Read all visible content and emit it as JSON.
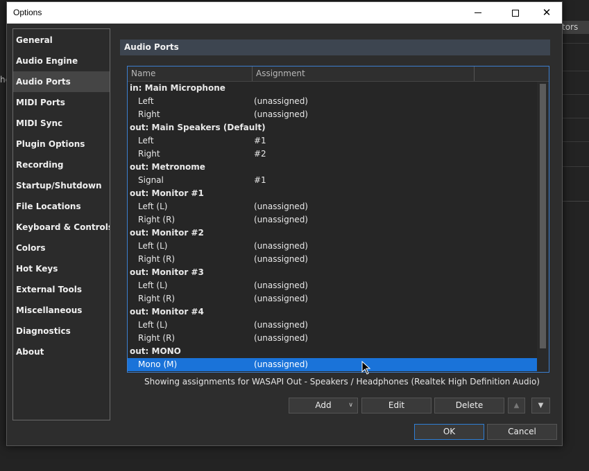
{
  "background": {
    "partial_tab_label": "tors",
    "partial_left_text": "he"
  },
  "window": {
    "title": "Options"
  },
  "sidebar": {
    "items": [
      {
        "label": "General"
      },
      {
        "label": "Audio Engine"
      },
      {
        "label": "Audio Ports",
        "selected": true
      },
      {
        "label": "MIDI Ports"
      },
      {
        "label": "MIDI Sync"
      },
      {
        "label": "Plugin Options"
      },
      {
        "label": "Recording"
      },
      {
        "label": "Startup/Shutdown"
      },
      {
        "label": "File Locations"
      },
      {
        "label": "Keyboard & Controls"
      },
      {
        "label": "Colors"
      },
      {
        "label": "Hot Keys"
      },
      {
        "label": "External Tools"
      },
      {
        "label": "Miscellaneous"
      },
      {
        "label": "Diagnostics"
      },
      {
        "label": "About"
      }
    ]
  },
  "main": {
    "header": "Audio Ports",
    "table": {
      "columns": [
        "Name",
        "Assignment"
      ],
      "rows": [
        {
          "group": "in: Main Microphone"
        },
        {
          "name": "Left",
          "assignment": "(unassigned)"
        },
        {
          "name": "Right",
          "assignment": "(unassigned)"
        },
        {
          "group": "out: Main Speakers (Default)"
        },
        {
          "name": "Left",
          "assignment": "#1"
        },
        {
          "name": "Right",
          "assignment": "#2"
        },
        {
          "group": "out: Metronome"
        },
        {
          "name": "Signal",
          "assignment": "#1"
        },
        {
          "group": "out: Monitor #1"
        },
        {
          "name": "Left (L)",
          "assignment": "(unassigned)"
        },
        {
          "name": "Right (R)",
          "assignment": "(unassigned)"
        },
        {
          "group": "out: Monitor #2"
        },
        {
          "name": "Left (L)",
          "assignment": "(unassigned)"
        },
        {
          "name": "Right (R)",
          "assignment": "(unassigned)"
        },
        {
          "group": "out: Monitor #3"
        },
        {
          "name": "Left (L)",
          "assignment": "(unassigned)"
        },
        {
          "name": "Right (R)",
          "assignment": "(unassigned)"
        },
        {
          "group": "out: Monitor #4"
        },
        {
          "name": "Left (L)",
          "assignment": "(unassigned)"
        },
        {
          "name": "Right (R)",
          "assignment": "(unassigned)"
        },
        {
          "group": "out: MONO"
        },
        {
          "name": "Mono (M)",
          "assignment": "(unassigned)",
          "selected": true
        }
      ]
    },
    "footer_note": "Showing assignments for WASAPI Out - Speakers / Headphones (Realtek High Definition Audio)",
    "buttons": {
      "add": "Add",
      "edit": "Edit",
      "delete": "Delete",
      "up_icon": "arrow-up-icon",
      "down_icon": "arrow-down-icon"
    }
  },
  "dialog_buttons": {
    "ok": "OK",
    "cancel": "Cancel"
  },
  "colors": {
    "selection": "#1a73d9",
    "header_bg": "#3d4550",
    "dialog_bg": "#2d2d2d"
  }
}
